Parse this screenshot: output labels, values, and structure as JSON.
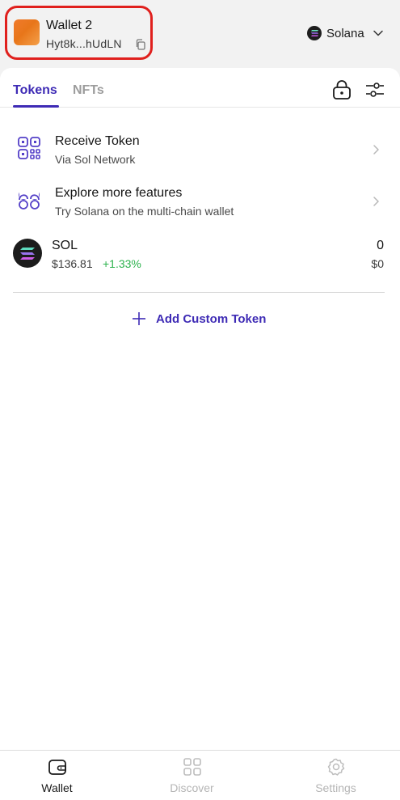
{
  "header": {
    "wallet_name": "Wallet 2",
    "wallet_address": "Hyt8k...hUdLN",
    "network": "Solana"
  },
  "tabs": [
    {
      "label": "Tokens",
      "active": true
    },
    {
      "label": "NFTs",
      "active": false
    }
  ],
  "actions": [
    {
      "title": "Receive Token",
      "subtitle": "Via Sol Network",
      "icon": "qr-code-icon"
    },
    {
      "title": "Explore more features",
      "subtitle": "Try Solana on the multi-chain wallet",
      "icon": "explore-icon"
    }
  ],
  "tokens": [
    {
      "symbol": "SOL",
      "price": "$136.81",
      "change": "+1.33%",
      "quantity": "0",
      "value": "$0"
    }
  ],
  "add_custom_token_label": "Add Custom Token",
  "bottom_nav": [
    {
      "label": "Wallet",
      "active": true,
      "icon": "wallet-icon"
    },
    {
      "label": "Discover",
      "active": false,
      "icon": "grid-icon"
    },
    {
      "label": "Settings",
      "active": false,
      "icon": "gear-icon"
    }
  ],
  "colors": {
    "accent": "#3e2bb5",
    "positive": "#2bb24c",
    "highlight": "#e0201d"
  }
}
